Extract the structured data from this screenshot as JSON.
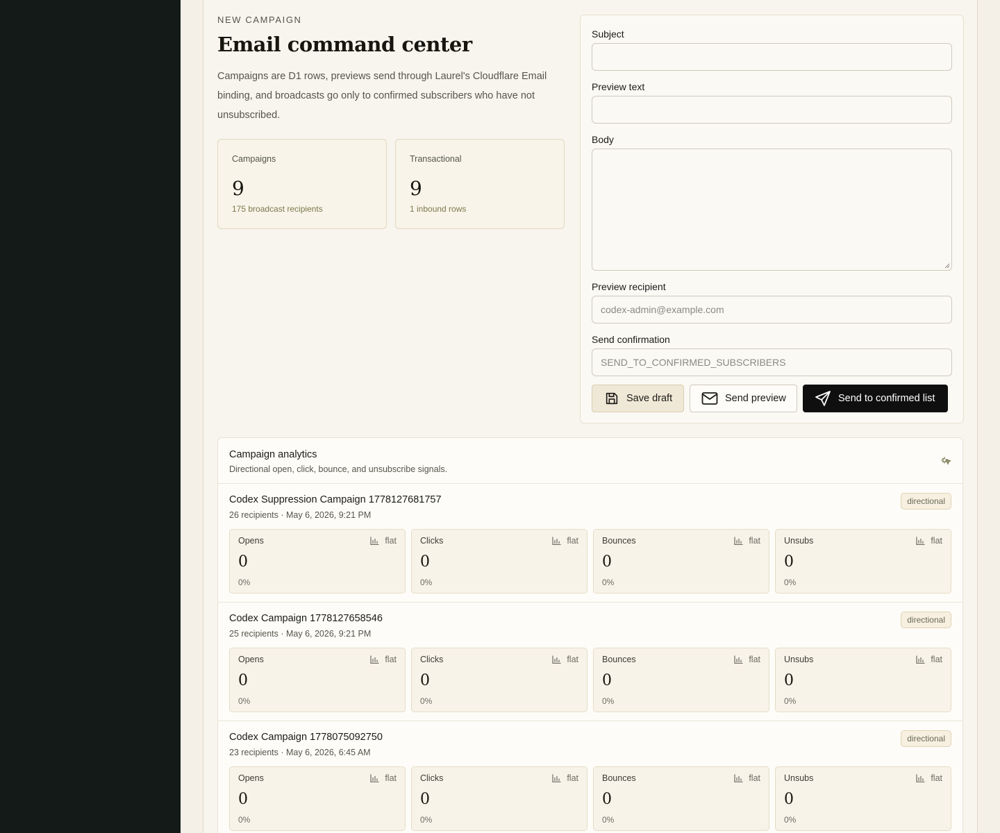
{
  "header": {
    "eyebrow": "NEW CAMPAIGN",
    "title": "Email command center",
    "description": "Campaigns are D1 rows, previews send through Laurel's Cloudflare Email binding, and broadcasts go only to confirmed subscribers who have not unsubscribed."
  },
  "stats": [
    {
      "label": "Campaigns",
      "value": "9",
      "sub": "175 broadcast recipients"
    },
    {
      "label": "Transactional",
      "value": "9",
      "sub": "1 inbound rows"
    }
  ],
  "form": {
    "subject_label": "Subject",
    "subject_value": "",
    "preview_text_label": "Preview text",
    "preview_text_value": "",
    "body_label": "Body",
    "body_value": "",
    "preview_recipient_label": "Preview recipient",
    "preview_recipient_placeholder": "codex-admin@example.com",
    "send_confirmation_label": "Send confirmation",
    "send_confirmation_placeholder": "SEND_TO_CONFIRMED_SUBSCRIBERS",
    "save_label": "Save draft",
    "preview_label": "Send preview",
    "send_label": "Send to confirmed list"
  },
  "analytics": {
    "title": "Campaign analytics",
    "subtitle": "Directional open, click, bounce, and unsubscribe signals.",
    "icon": "sparkle-icon",
    "campaigns": [
      {
        "name": "Codex Suppression Campaign 1778127681757",
        "meta": "26 recipients · May 6, 2026, 9:21 PM",
        "badge": "directional",
        "metrics": [
          {
            "label": "Opens",
            "trend": "flat",
            "value": "0",
            "pct": "0%"
          },
          {
            "label": "Clicks",
            "trend": "flat",
            "value": "0",
            "pct": "0%"
          },
          {
            "label": "Bounces",
            "trend": "flat",
            "value": "0",
            "pct": "0%"
          },
          {
            "label": "Unsubs",
            "trend": "flat",
            "value": "0",
            "pct": "0%"
          }
        ]
      },
      {
        "name": "Codex Campaign 1778127658546",
        "meta": "25 recipients · May 6, 2026, 9:21 PM",
        "badge": "directional",
        "metrics": [
          {
            "label": "Opens",
            "trend": "flat",
            "value": "0",
            "pct": "0%"
          },
          {
            "label": "Clicks",
            "trend": "flat",
            "value": "0",
            "pct": "0%"
          },
          {
            "label": "Bounces",
            "trend": "flat",
            "value": "0",
            "pct": "0%"
          },
          {
            "label": "Unsubs",
            "trend": "flat",
            "value": "0",
            "pct": "0%"
          }
        ]
      },
      {
        "name": "Codex Campaign 1778075092750",
        "meta": "23 recipients · May 6, 2026, 6:45 AM",
        "badge": "directional",
        "metrics": [
          {
            "label": "Opens",
            "trend": "flat",
            "value": "0",
            "pct": "0%"
          },
          {
            "label": "Clicks",
            "trend": "flat",
            "value": "0",
            "pct": "0%"
          },
          {
            "label": "Bounces",
            "trend": "flat",
            "value": "0",
            "pct": "0%"
          },
          {
            "label": "Unsubs",
            "trend": "flat",
            "value": "0",
            "pct": "0%"
          }
        ]
      }
    ]
  },
  "colors": {
    "sidebar": "#141a17",
    "background": "#f4f0e8",
    "primary_button": "#0f0f0f",
    "accent_muted": "#7a7a4a"
  }
}
